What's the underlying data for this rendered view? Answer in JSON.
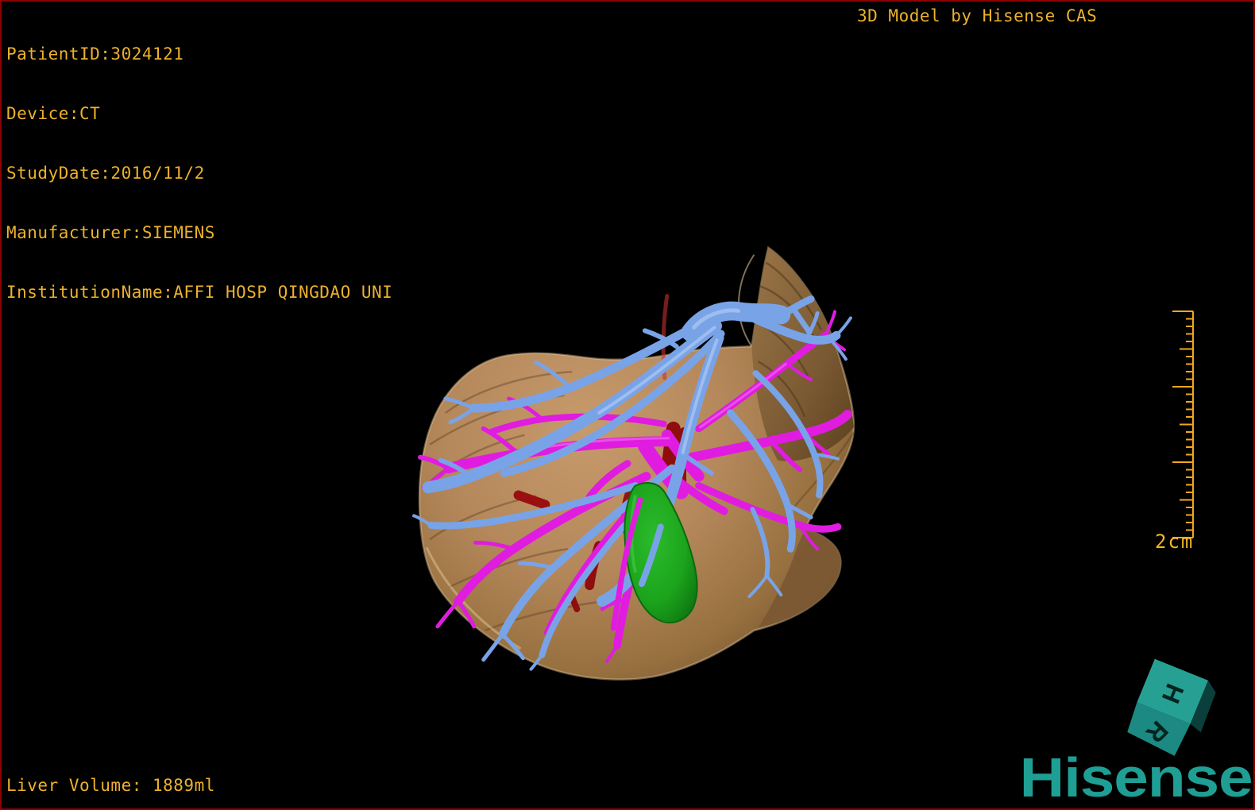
{
  "header": {
    "info_lines": [
      "PatientID:3024121",
      "Device:CT",
      "StudyDate:2016/11/2",
      "Manufacturer:SIEMENS",
      "InstitutionName:AFFI HOSP QINGDAO UNI"
    ],
    "title": "3D Model by Hisense CAS"
  },
  "scale_bar": {
    "label": "2cm"
  },
  "footer": {
    "liver_volume_label": "Liver Volume: 1889ml"
  },
  "branding": {
    "logo_text": "Hisense",
    "cube_top_letter": "H",
    "cube_front_letter": "R"
  },
  "colors": {
    "annotation_text": "#EDB12D",
    "frame_border": "#8B0000",
    "background": "#000000",
    "liver": "#B98E60",
    "hepatic_vein_blue": "#79A3E7",
    "portal_vein_magenta": "#E01CE0",
    "vena_cava_red": "#9A1010",
    "gallbladder_green": "#1CA41C",
    "scale_bar_yellow": "#F2A71F",
    "brand_teal": "#1F9E94"
  },
  "model_structures": [
    {
      "name": "liver",
      "color": "#B98E60"
    },
    {
      "name": "hepatic-veins",
      "color": "#79A3E7"
    },
    {
      "name": "portal-veins",
      "color": "#E01CE0"
    },
    {
      "name": "inferior-vena-cava",
      "color": "#9A1010"
    },
    {
      "name": "gallbladder",
      "color": "#1CA41C"
    }
  ]
}
